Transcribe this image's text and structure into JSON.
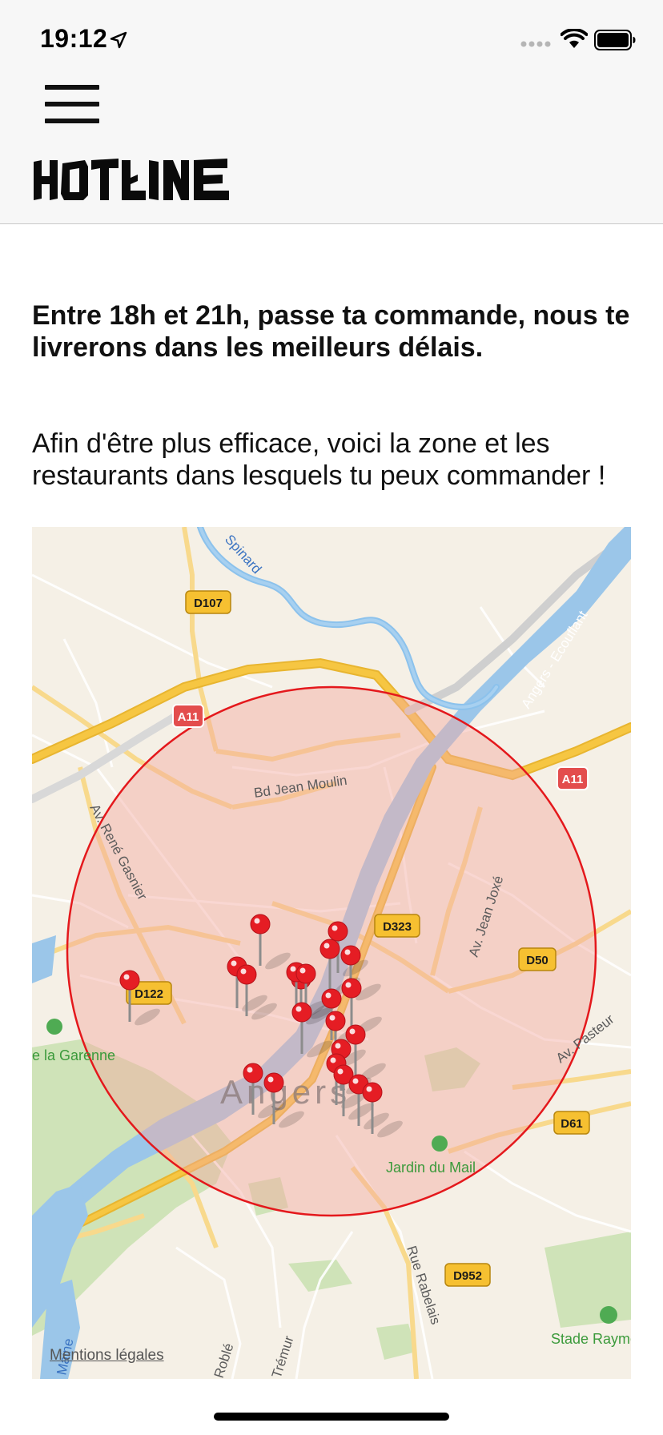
{
  "status_bar": {
    "time": "19:12",
    "icons": [
      "location-arrow-icon",
      "signal-icon",
      "wifi-icon",
      "battery-icon"
    ]
  },
  "header": {
    "menu_icon": "hamburger-menu-icon",
    "logo_text": "HOTLINE"
  },
  "content": {
    "intro": "Entre 18h et 21h, passe ta commande, nous te livrerons dans les meilleurs délais.",
    "zone": "Afin d'être plus efficace, voici la zone et les restaurants dans lesquels tu peux commander !"
  },
  "map": {
    "city_label": "Angers",
    "street_labels": [
      "Bd Jean Moulin",
      "Av. René Gasnier",
      "Av. Jean Joxé",
      "Av. Pasteur",
      "Rue Rabelais",
      "Angers - Ecouflant",
      "Spinard",
      "Maine",
      "Trémur",
      "Roblé"
    ],
    "road_badges": [
      "D107",
      "A11",
      "A11",
      "D323",
      "D50",
      "D122",
      "D61",
      "D952"
    ],
    "place_labels": [
      "e la Garenne",
      "Jardin du Mail",
      "Stade Raymond K"
    ],
    "legal_link": "Mentions légales",
    "colors": {
      "zone_fill": "#f4c5c0",
      "zone_stroke": "#e4181c",
      "pin": "#e51d24",
      "water": "#9bc6e9",
      "highway": "#f6c642",
      "park": "#bfdca6"
    }
  }
}
